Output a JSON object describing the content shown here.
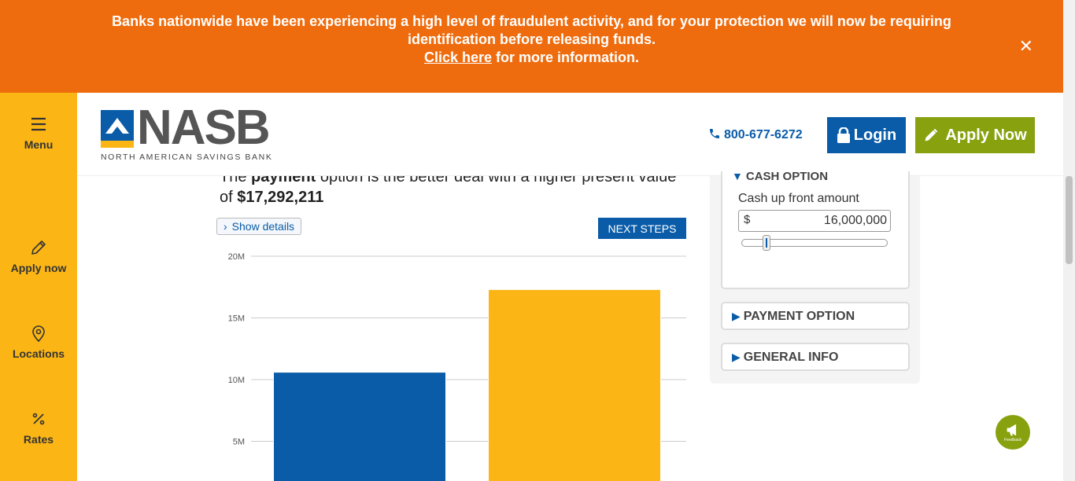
{
  "alert": {
    "line1": "Banks nationwide have been experiencing a high level of fraudulent activity, and for your protection we will now be requiring identification before releasing funds.",
    "link_text": "Click here",
    "link_suffix": " for more information.",
    "close_symbol": "✕"
  },
  "nav": {
    "menu": "Menu",
    "apply": "Apply now",
    "locations": "Locations",
    "rates": "Rates"
  },
  "header": {
    "logo_word": "NASB",
    "logo_sub": "NORTH AMERICAN SAVINGS BANK",
    "phone": "800-677-6272",
    "login": "Login",
    "apply": "Apply Now"
  },
  "result": {
    "intro": "The ",
    "strong": "payment",
    "rest": " option is the better deal with a higher present value of ",
    "value": "$17,292,211"
  },
  "actions": {
    "show_details": "Show details",
    "next_steps": "NEXT STEPS"
  },
  "chart_data": {
    "type": "bar",
    "categories": [
      "",
      ""
    ],
    "values": [
      10.6,
      17.3
    ],
    "colors": [
      "#0a5ca8",
      "#fbb616"
    ],
    "ylim": [
      0,
      20
    ],
    "yticks": [
      5,
      10,
      15,
      20
    ],
    "ytick_labels": [
      "5M",
      "10M",
      "15M",
      "20M"
    ],
    "title": "",
    "xlabel": "",
    "ylabel": "",
    "grid": true
  },
  "panel": {
    "cash_heading": "CASH OPTION",
    "cash_label": "Cash up front amount",
    "currency": "$",
    "cash_value": "16,000,000",
    "slider_fraction": 0.15,
    "payment_heading": "PAYMENT OPTION",
    "general_heading": "GENERAL INFO"
  },
  "feedback": {
    "label": "Feedback"
  },
  "colors": {
    "orange": "#ef6c0e",
    "yellow": "#fbb616",
    "blue": "#0a5ca8",
    "green": "#87a10f"
  }
}
